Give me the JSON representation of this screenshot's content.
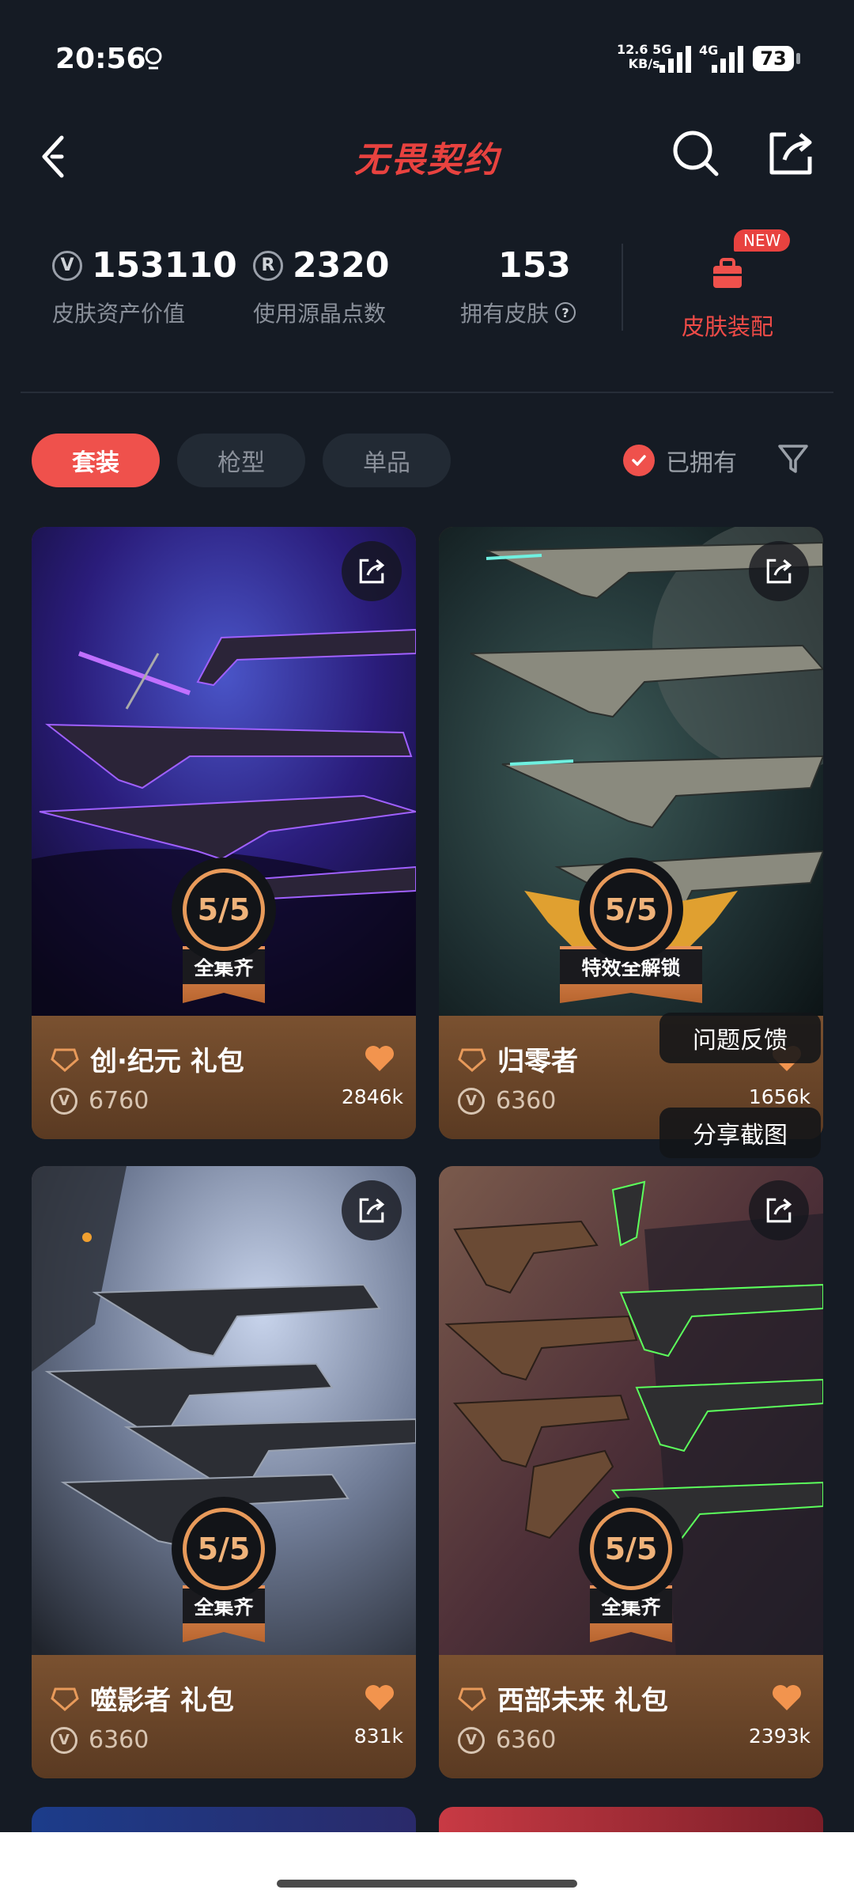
{
  "status_bar": {
    "time": "20:56",
    "net_speed_value": "12.6",
    "net_speed_unit": "KB/s",
    "net_type_1": "5G",
    "net_type_2": "4G",
    "battery": "73"
  },
  "header": {
    "title": "无畏契约",
    "title_color": "#e8423f"
  },
  "stats": [
    {
      "value": "153110",
      "label": "皮肤资产价值",
      "icon": "vp-coin-icon"
    },
    {
      "value": "2320",
      "label": "使用源晶点数",
      "icon": "radianite-icon"
    },
    {
      "value": "153",
      "label": "拥有皮肤",
      "icon": "help-icon"
    }
  ],
  "equip": {
    "badge": "NEW",
    "label": "皮肤装配"
  },
  "tabs": [
    {
      "label": "套装",
      "active": true
    },
    {
      "label": "枪型",
      "active": false
    },
    {
      "label": "单品",
      "active": false
    }
  ],
  "owned_filter": {
    "label": "已拥有",
    "checked": true
  },
  "cards": [
    {
      "name": "创·纪元 礼包",
      "price": "6760",
      "likes": "2846k",
      "progress": "5/5",
      "ribbon": "全集齐"
    },
    {
      "name": "归零者",
      "price": "6360",
      "likes": "1656k",
      "progress": "5/5",
      "ribbon": "特效全解锁"
    },
    {
      "name": "噬影者 礼包",
      "price": "6360",
      "likes": "831k",
      "progress": "5/5",
      "ribbon": "全集齐"
    },
    {
      "name": "西部未来 礼包",
      "price": "6360",
      "likes": "2393k",
      "progress": "5/5",
      "ribbon": "全集齐"
    }
  ],
  "floating": {
    "feedback": "问题反馈",
    "screenshot": "分享截图"
  }
}
